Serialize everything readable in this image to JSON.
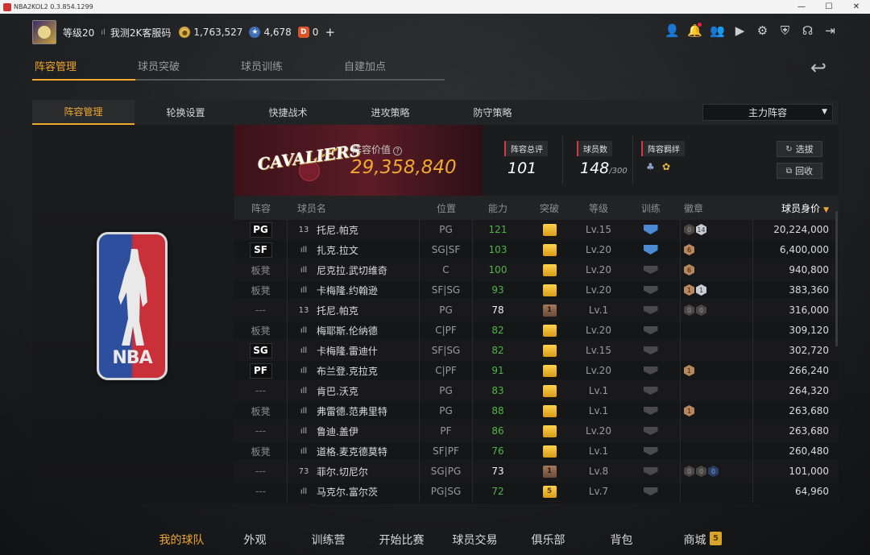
{
  "window": {
    "title": "NBA2KOL2 0.3.854.1299",
    "controls": [
      "—",
      "☐",
      "✕"
    ]
  },
  "header": {
    "level": "等级20",
    "signal_icon": "signal-icon",
    "server": "我测2K客服码",
    "coins": "1,763,527",
    "stars": "4,678",
    "points": "0",
    "plus": "+"
  },
  "top_icons": [
    "user-icon",
    "bell-icon",
    "friends-icon",
    "video-icon",
    "gear-icon",
    "shield-icon",
    "headset-icon",
    "exit-icon"
  ],
  "section_tabs": [
    {
      "label": "阵容管理",
      "active": true
    },
    {
      "label": "球员突破",
      "active": false
    },
    {
      "label": "球员训练",
      "active": false
    },
    {
      "label": "自建加点",
      "active": false
    }
  ],
  "subtabs": [
    {
      "label": "阵容管理",
      "active": true
    },
    {
      "label": "轮换设置",
      "active": false
    },
    {
      "label": "快捷战术",
      "active": false
    },
    {
      "label": "进攻策略",
      "active": false
    },
    {
      "label": "防守策略",
      "active": false
    }
  ],
  "lineup_select": "主力阵容",
  "team": {
    "logo_text": "CAVALIERS",
    "value_label": "阵容价值",
    "value": "29,358,840",
    "rating_label": "阵容总评",
    "rating": "101",
    "count_label": "球员数",
    "count": "148",
    "count_max": "/300",
    "chem_label": "阵容羁绊",
    "btn_select": "选拔",
    "btn_recycle": "回收"
  },
  "nba_logo_text": "NBA",
  "table": {
    "headers": {
      "pos": "阵容",
      "name": "球员名",
      "role": "位置",
      "ability": "能力",
      "break": "突破",
      "level": "等级",
      "train": "训练",
      "badge": "徽章",
      "value": "球员身价"
    },
    "rows": [
      {
        "pos": "PG",
        "posType": "badge",
        "num": "13",
        "name": "托尼.帕克",
        "role": "PG",
        "ability": "121",
        "abilityColor": "green",
        "brk": "gold",
        "brkText": "",
        "level": "Lv.15",
        "train": "blue",
        "badges": [
          {
            "t": "dark",
            "v": "0"
          },
          {
            "t": "silver",
            "v": "14"
          }
        ],
        "value": "20,224,000"
      },
      {
        "pos": "SF",
        "posType": "badge",
        "num": "ıll",
        "name": "扎克.拉文",
        "role": "SG|SF",
        "ability": "103",
        "abilityColor": "green",
        "brk": "gold",
        "brkText": "",
        "level": "Lv.20",
        "train": "blue",
        "badges": [
          {
            "t": "bronze",
            "v": "6"
          }
        ],
        "value": "6,400,000"
      },
      {
        "pos": "板凳",
        "posType": "bench",
        "num": "ıll",
        "name": "尼克拉.武切维奇",
        "role": "C",
        "ability": "100",
        "abilityColor": "green",
        "brk": "gold",
        "brkText": "",
        "level": "Lv.20",
        "train": "gray",
        "badges": [
          {
            "t": "bronze",
            "v": "6"
          }
        ],
        "value": "940,800"
      },
      {
        "pos": "板凳",
        "posType": "bench",
        "num": "ıll",
        "name": "卡梅隆.约翰逊",
        "role": "SF|SG",
        "ability": "93",
        "abilityColor": "green",
        "brk": "gold",
        "brkText": "",
        "level": "Lv.20",
        "train": "gray",
        "badges": [
          {
            "t": "bronze",
            "v": "1"
          },
          {
            "t": "silver",
            "v": "1"
          }
        ],
        "value": "383,360"
      },
      {
        "pos": "---",
        "posType": "dash",
        "num": "13",
        "name": "托尼.帕克",
        "role": "PG",
        "ability": "78",
        "abilityColor": "white",
        "brk": "bronze",
        "brkText": "1",
        "level": "Lv.1",
        "train": "gray",
        "badges": [
          {
            "t": "dark",
            "v": "0"
          },
          {
            "t": "dark",
            "v": "0"
          }
        ],
        "value": "316,000"
      },
      {
        "pos": "板凳",
        "posType": "bench",
        "num": "ıll",
        "name": "梅耶斯.伦纳德",
        "role": "C|PF",
        "ability": "82",
        "abilityColor": "green",
        "brk": "gold",
        "brkText": "",
        "level": "Lv.20",
        "train": "gray",
        "badges": [],
        "value": "309,120"
      },
      {
        "pos": "SG",
        "posType": "badge",
        "num": "ıll",
        "name": "卡梅隆.雷迪什",
        "role": "SF|SG",
        "ability": "82",
        "abilityColor": "green",
        "brk": "gold",
        "brkText": "",
        "level": "Lv.15",
        "train": "gray",
        "badges": [],
        "value": "302,720"
      },
      {
        "pos": "PF",
        "posType": "badge",
        "num": "ıll",
        "name": "布兰登.克拉克",
        "role": "C|PF",
        "ability": "91",
        "abilityColor": "green",
        "brk": "gold",
        "brkText": "",
        "level": "Lv.20",
        "train": "gray",
        "badges": [
          {
            "t": "bronze",
            "v": "1"
          }
        ],
        "value": "266,240"
      },
      {
        "pos": "---",
        "posType": "dash",
        "num": "ıll",
        "name": "肯巴.沃克",
        "role": "PG",
        "ability": "83",
        "abilityColor": "green",
        "brk": "gold",
        "brkText": "",
        "level": "Lv.1",
        "train": "gray",
        "badges": [],
        "value": "264,320"
      },
      {
        "pos": "板凳",
        "posType": "bench",
        "num": "ıll",
        "name": "弗雷德.范弗里特",
        "role": "PG",
        "ability": "88",
        "abilityColor": "green",
        "brk": "gold",
        "brkText": "",
        "level": "Lv.1",
        "train": "gray",
        "badges": [
          {
            "t": "bronze",
            "v": "1"
          }
        ],
        "value": "263,680"
      },
      {
        "pos": "---",
        "posType": "dash",
        "num": "ıll",
        "name": "鲁迪.盖伊",
        "role": "PF",
        "ability": "86",
        "abilityColor": "green",
        "brk": "gold",
        "brkText": "",
        "level": "Lv.20",
        "train": "gray",
        "badges": [],
        "value": "263,680"
      },
      {
        "pos": "板凳",
        "posType": "bench",
        "num": "ıll",
        "name": "道格.麦克德莫特",
        "role": "SF|PF",
        "ability": "76",
        "abilityColor": "green",
        "brk": "gold",
        "brkText": "",
        "level": "Lv.1",
        "train": "gray",
        "badges": [],
        "value": "260,480"
      },
      {
        "pos": "---",
        "posType": "dash",
        "num": "73",
        "name": "菲尔.切尼尔",
        "role": "SG|PG",
        "ability": "73",
        "abilityColor": "white",
        "brk": "bronze",
        "brkText": "1",
        "level": "Lv.8",
        "train": "gray",
        "badges": [
          {
            "t": "dark",
            "v": "0"
          },
          {
            "t": "dark",
            "v": "0"
          },
          {
            "t": "blue",
            "v": "0"
          }
        ],
        "value": "101,000"
      },
      {
        "pos": "---",
        "posType": "dash",
        "num": "ıll",
        "name": "马克尔.富尔茨",
        "role": "PG|SG",
        "ability": "72",
        "abilityColor": "green",
        "brk": "gold",
        "brkText": "5",
        "level": "Lv.7",
        "train": "gray",
        "badges": [],
        "value": "64,960"
      }
    ]
  },
  "bottom_nav": [
    {
      "label": "我的球队",
      "active": true
    },
    {
      "label": "外观",
      "active": false
    },
    {
      "label": "训练营",
      "active": false
    },
    {
      "label": "开始比赛",
      "active": false
    },
    {
      "label": "球员交易",
      "active": false
    },
    {
      "label": "俱乐部",
      "active": false
    },
    {
      "label": "背包",
      "active": false
    },
    {
      "label": "商城",
      "active": false
    }
  ],
  "shop_badge": "5",
  "colors": {
    "accent": "#f0a830",
    "green": "#4fb548",
    "panel": "#141517",
    "cavs_wine": "#5c1c26"
  }
}
